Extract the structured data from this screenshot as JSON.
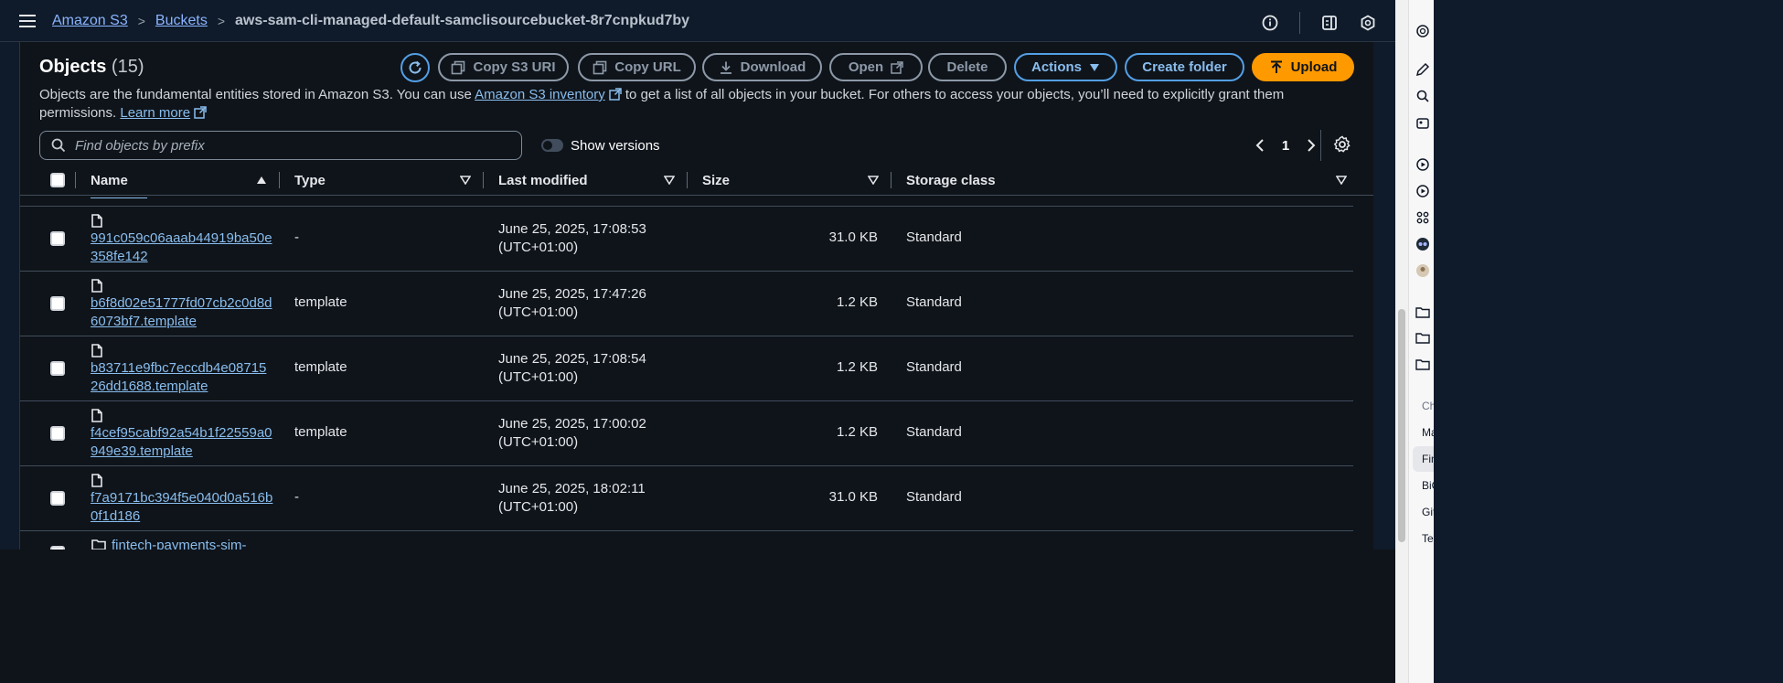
{
  "breadcrumb": {
    "items": [
      "Amazon S3",
      "Buckets"
    ],
    "current": "aws-sam-cli-managed-default-samclisourcebucket-8r7cnpkud7by"
  },
  "panel": {
    "title": "Objects",
    "count": "(15)",
    "description_pre": "Objects are the fundamental entities stored in Amazon S3. You can use ",
    "inventory_link": "Amazon S3 inventory",
    "description_post": " to get a list of all objects in your bucket. For others to access your objects, you’ll need to explicitly grant them permissions.",
    "learn_more": "Learn more"
  },
  "toolbar": {
    "copy_s3_uri": "Copy S3 URI",
    "copy_url": "Copy URL",
    "download": "Download",
    "open": "Open",
    "delete": "Delete",
    "actions": "Actions",
    "create_folder": "Create folder",
    "upload": "Upload"
  },
  "search": {
    "placeholder": "Find objects by prefix"
  },
  "versions_toggle": {
    "label": "Show versions",
    "on": false
  },
  "pagination": {
    "page": "1"
  },
  "table": {
    "headers": [
      "Name",
      "Type",
      "Last modified",
      "Size",
      "Storage class"
    ],
    "rows": [
      {
        "name": "991c059c06aaab44919ba50e358fe142",
        "type": "-",
        "modified": "June 25, 2025, 17:08:53 (UTC+01:00)",
        "size": "31.0 KB",
        "storage": "Standard"
      },
      {
        "name": "b6f8d02e51777fd07cb2c0d8d6073bf7.template",
        "type": "template",
        "modified": "June 25, 2025, 17:47:26 (UTC+01:00)",
        "size": "1.2 KB",
        "storage": "Standard"
      },
      {
        "name": "b83711e9fbc7eccdb4e0871526dd1688.template",
        "type": "template",
        "modified": "June 25, 2025, 17:08:54 (UTC+01:00)",
        "size": "1.2 KB",
        "storage": "Standard"
      },
      {
        "name": "f4cef95cabf92a54b1f22559a0949e39.template",
        "type": "template",
        "modified": "June 25, 2025, 17:00:02 (UTC+01:00)",
        "size": "1.2 KB",
        "storage": "Standard"
      },
      {
        "name": "f7a9171bc394f5e040d0a516b0f1d186",
        "type": "-",
        "modified": "June 25, 2025, 18:02:11 (UTC+01:00)",
        "size": "31.0 KB",
        "storage": "Standard"
      }
    ],
    "partial_folder": "fintech-payments-sim-"
  },
  "siderail_labels": [
    "Ch",
    "Ma",
    "Fin",
    "BiG",
    "Git",
    "Ter"
  ],
  "colors": {
    "link": "#89bdee",
    "accent_blue": "#539fe5",
    "upload_orange": "#ff9900",
    "background": "#0f141a"
  }
}
